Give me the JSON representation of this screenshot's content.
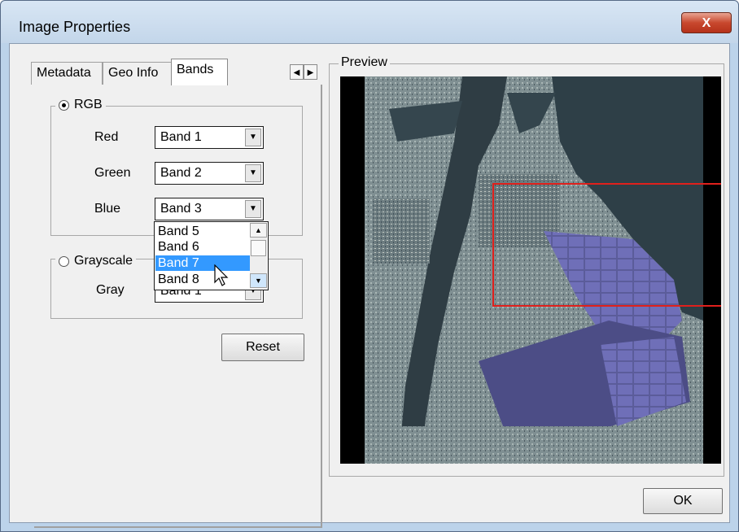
{
  "window": {
    "title": "Image Properties",
    "close_label": "X"
  },
  "tabs": [
    {
      "label": "Metadata",
      "active": false
    },
    {
      "label": "Geo Info",
      "active": false
    },
    {
      "label": "Bands",
      "active": true
    }
  ],
  "tab_scroll": {
    "left_icon": "◀",
    "right_icon": "▶"
  },
  "rgb_group": {
    "label": "RGB",
    "selected": true,
    "red": {
      "label": "Red",
      "value": "Band 1"
    },
    "green": {
      "label": "Green",
      "value": "Band 2"
    },
    "blue": {
      "label": "Blue",
      "value": "Band 3"
    }
  },
  "blue_dropdown_list": {
    "items": [
      "Band 5",
      "Band 6",
      "Band 7",
      "Band 8"
    ],
    "selected": "Band 7"
  },
  "grayscale_group": {
    "label": "Grayscale",
    "selected": false,
    "gray": {
      "label": "Gray",
      "value": "Band 1"
    }
  },
  "reset_label": "Reset",
  "preview": {
    "label": "Preview",
    "highlight_color": "#e0201c"
  },
  "ok_label": "OK",
  "icons": {
    "dropdown_arrow": "▼",
    "scroll_up": "▲",
    "scroll_down": "▼"
  }
}
